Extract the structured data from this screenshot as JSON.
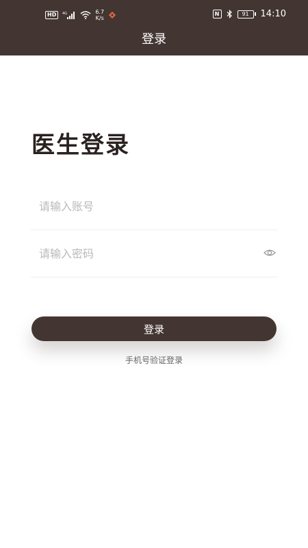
{
  "status_bar": {
    "hd": "HD",
    "network": "4G",
    "speed_value": "6.7",
    "speed_unit": "K/s",
    "battery": "91",
    "time": "14:10"
  },
  "header": {
    "title": "登录"
  },
  "main": {
    "heading": "医生登录",
    "account_placeholder": "请输入账号",
    "password_placeholder": "请输入密码",
    "login_button": "登录",
    "sms_login_link": "手机号验证登录"
  },
  "colors": {
    "primary": "#433632",
    "heading": "#2a2220",
    "placeholder": "#b9b9b9"
  }
}
